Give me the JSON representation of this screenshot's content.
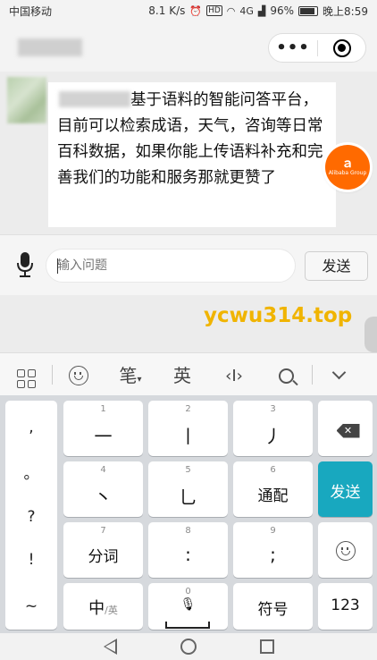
{
  "status_bar": {
    "carrier": "中国移动",
    "speed": "8.1 K/s",
    "network": "4G",
    "battery": "96%",
    "time": "晚上8:59"
  },
  "header": {
    "more_label": "•••"
  },
  "chat": {
    "message": "基于语料的智能问答平台，目前可以检索成语，天气，咨询等日常百科数据，如果你能上传语料补充和完善我们的功能和服务那就更赞了",
    "badge_text": "Alibaba Group"
  },
  "input": {
    "placeholder": "输入问题",
    "send_label": "发送"
  },
  "watermark": "ycwu314.top",
  "keyboard_toolbar": {
    "pen_label": "笔",
    "english_label": "英"
  },
  "keyboard": {
    "side_keys": [
      ",",
      "。",
      "?",
      "!",
      "~"
    ],
    "rows": [
      [
        {
          "num": "1",
          "label": "一"
        },
        {
          "num": "2",
          "label": "丨"
        },
        {
          "num": "3",
          "label": "丿"
        }
      ],
      [
        {
          "num": "4",
          "label": "丶"
        },
        {
          "num": "5",
          "label": "乚"
        },
        {
          "num": "6",
          "label": "通配"
        }
      ],
      [
        {
          "num": "7",
          "label": "分词"
        },
        {
          "num": "8",
          "label": ":"
        },
        {
          "num": "9",
          "label": ";"
        }
      ]
    ],
    "send_label": "发送",
    "lang_main": "中",
    "lang_sub": "/英",
    "space_num": "0",
    "symbols_label": "符号",
    "numbers_label": "123"
  }
}
